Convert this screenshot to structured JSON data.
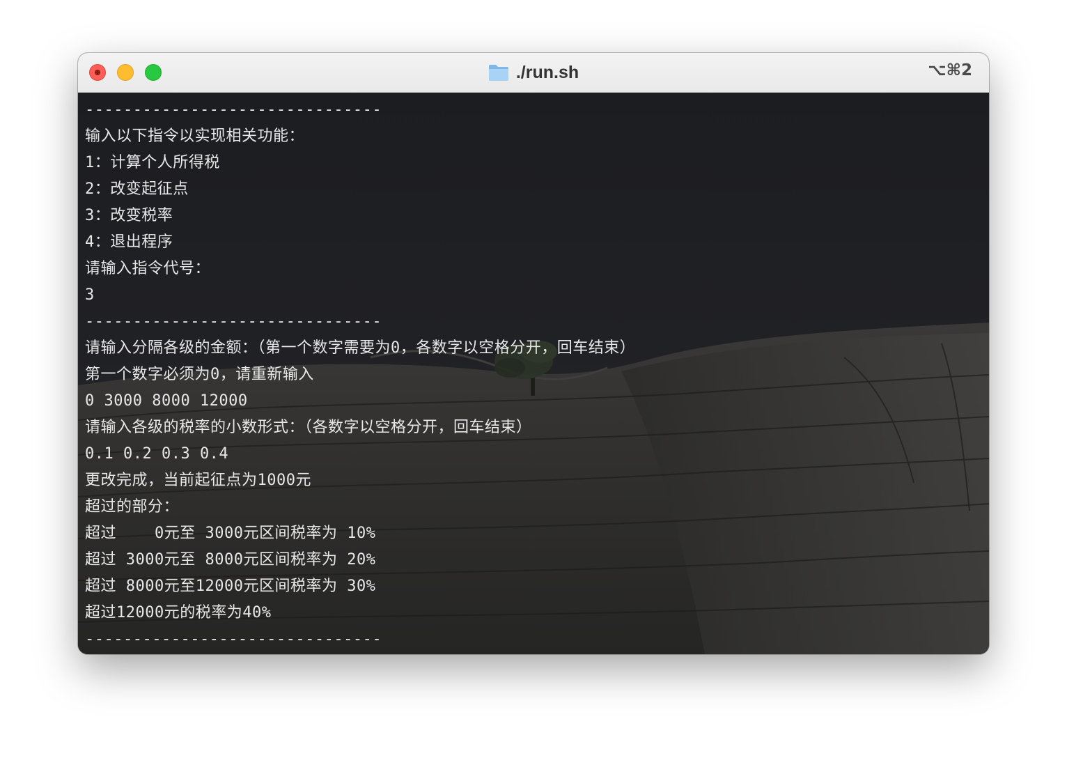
{
  "window": {
    "title": "./run.sh",
    "shortcut": "⌥⌘2"
  },
  "terminal": {
    "lines": [
      "-------------------------------",
      "输入以下指令以实现相关功能：",
      "1：计算个人所得税",
      "2：改变起征点",
      "3：改变税率",
      "4：退出程序",
      "请输入指令代号：",
      "3",
      "-------------------------------",
      "请输入分隔各级的金额：（第一个数字需要为0，各数字以空格分开，回车结束）",
      "第一个数字必须为0，请重新输入",
      "0 3000 8000 12000",
      "请输入各级的税率的小数形式：（各数字以空格分开，回车结束）",
      "0.1 0.2 0.3 0.4",
      "更改完成，当前起征点为1000元",
      "超过的部分：",
      "超过    0元至 3000元区间税率为 10%",
      "超过 3000元至 8000元区间税率为 20%",
      "超过 8000元至12000元区间税率为 30%",
      "超过12000元的税率为40%",
      "-------------------------------"
    ]
  },
  "colors": {
    "close": "#ff5f57",
    "minimize": "#febc2e",
    "maximize": "#28c840",
    "terminal_text": "#e8e8e8",
    "terminal_bg": "#222223"
  }
}
